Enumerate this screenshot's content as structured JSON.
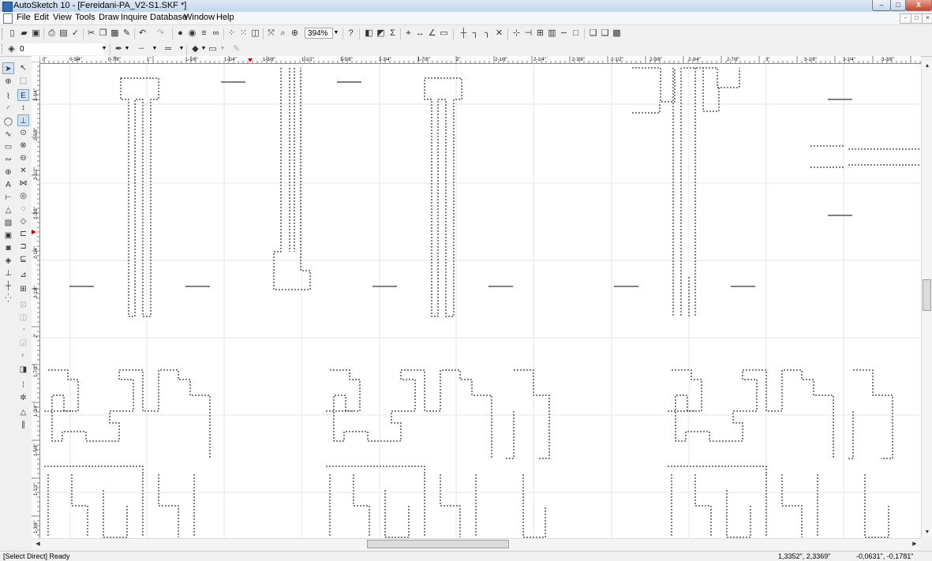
{
  "window": {
    "title": "AutoSketch 10 - [Fereidani-PA_V2-S1.SKF *]",
    "minimize_glyph": "–",
    "maximize_glyph": "□",
    "close_glyph": "X"
  },
  "menubar": {
    "items": [
      "File",
      "Edit",
      "View",
      "Tools",
      "Draw",
      "Inquire",
      "Database",
      "Window",
      "Help"
    ],
    "mdi_buttons": [
      "-",
      "□",
      "×"
    ]
  },
  "toolbar": {
    "zoom_value": "394%",
    "layer_value": "0"
  },
  "rulers": {
    "horizontal_labels": [
      "0\"",
      "0-3/4\"",
      "0-7/8\"",
      "1\"",
      "1-1/8\"",
      "1-1/4\"",
      "1-3/8\"",
      "1-1/2\"",
      "1-5/8\"",
      "1-3/4\"",
      "1-7/8\"",
      "2\"",
      "2-1/8\"",
      "2-1/4\"",
      "2-3/8\"",
      "2-1/2\"",
      "2-5/8\"",
      "2-3/4\"",
      "2-7/8\"",
      "3\"",
      "3-1/8\"",
      "3-1/4\"",
      "3-3/8\""
    ],
    "vertical_labels": [
      "2-3/4\"",
      "2-5/8\"",
      "2-1/2\"",
      "2-3/8\"",
      "2-1/4\"",
      "2-1/8\"",
      "2\"",
      "1-7/8\"",
      "1-3/4\"",
      "1-5/8\"",
      "1-1/2\"",
      "1-3/8\""
    ]
  },
  "status": {
    "message": "[Select Direct] Ready",
    "coordinates": "1,3352\", 2,3369\"",
    "delta": "-0,0631\", -0,1781\""
  },
  "icons": {
    "app": "autosketch-app-icon",
    "zoom_dropdown": "chevron-down-icon",
    "select_tool": "arrow-pointer-icon"
  }
}
